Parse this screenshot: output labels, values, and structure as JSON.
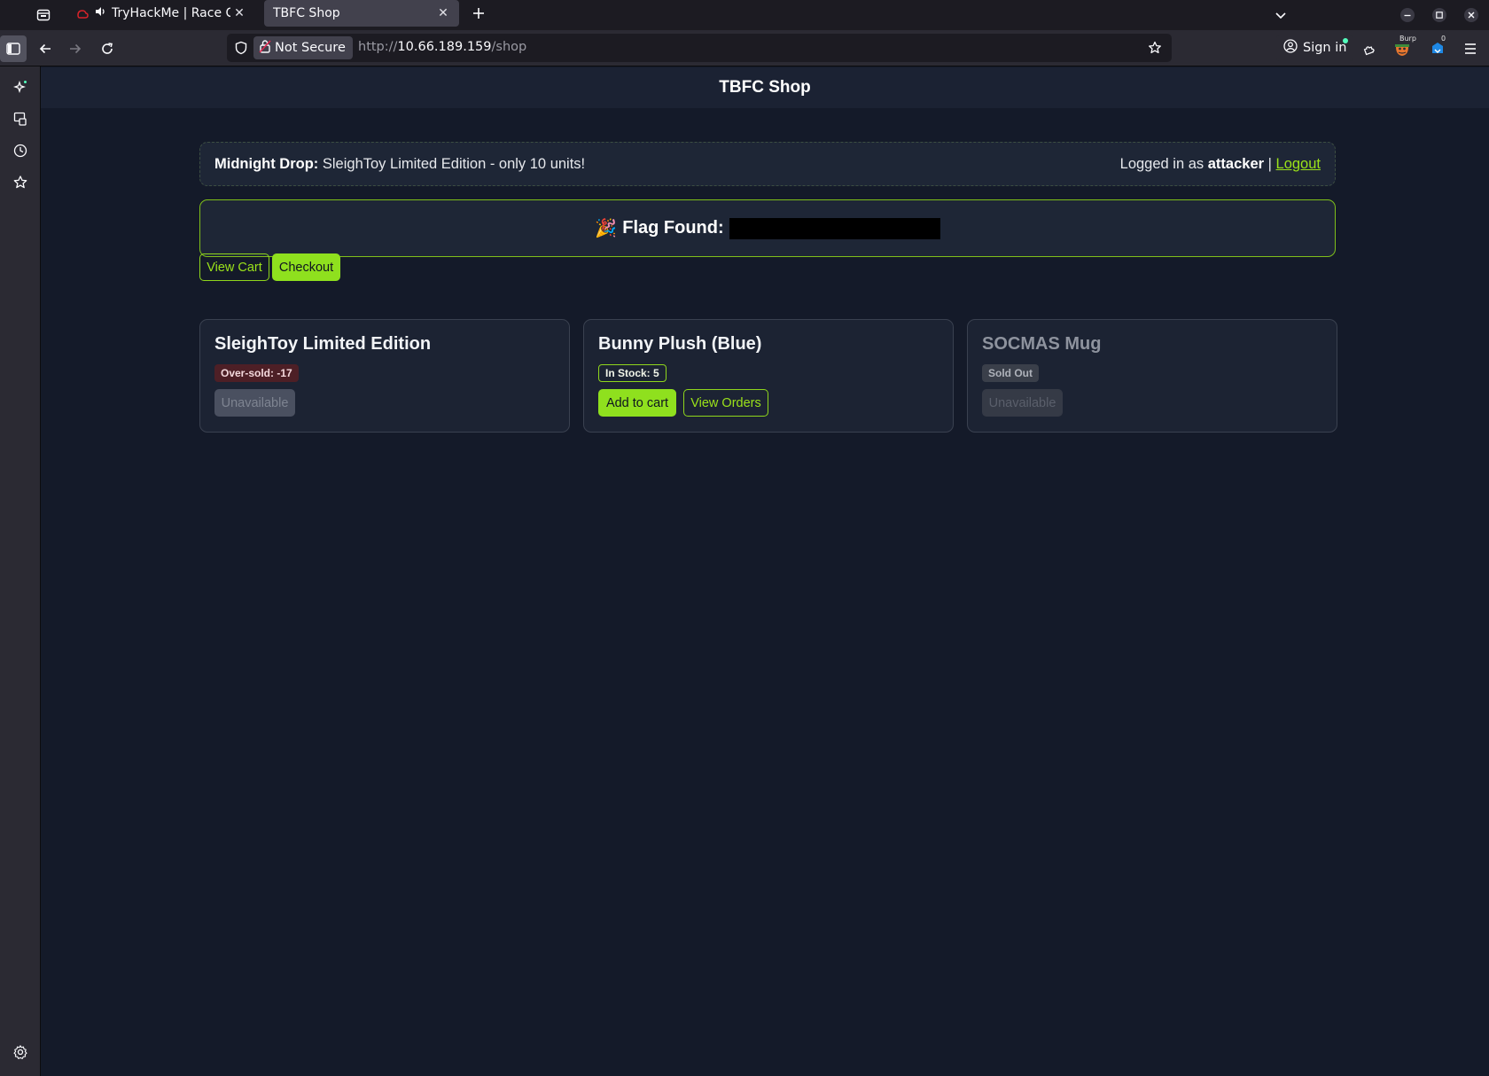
{
  "browser": {
    "tabs": [
      {
        "title": "TryHackMe | Race Cor",
        "active": false,
        "audio": true
      },
      {
        "title": "TBFC Shop",
        "active": true,
        "audio": false
      }
    ],
    "new_tab_label": "+",
    "security_label": "Not Secure",
    "url": {
      "prefix": "http://",
      "host": "10.66.189.159",
      "path": "/shop"
    },
    "sign_in_label": "Sign in",
    "burp_badge": "Burp",
    "ext_count": "0"
  },
  "page": {
    "site_title": "TBFC Shop",
    "banner": {
      "drop_label": "Midnight Drop:",
      "drop_text": "SleighToy Limited Edition - only 10 units!",
      "logged_prefix": "Logged in as",
      "username": "attacker",
      "separator": "|",
      "logout_label": "Logout"
    },
    "flag": {
      "emoji": "🎉",
      "label": "Flag Found:"
    },
    "actions": {
      "view_cart": "View Cart",
      "checkout": "Checkout"
    },
    "products": [
      {
        "name": "SleighToy Limited Edition",
        "badge": "Over-sold: -17",
        "badge_color": "#4d1f26",
        "button": "Unavailable"
      },
      {
        "name": "Bunny Plush (Blue)",
        "badge": "In Stock: 5",
        "badge_color": "#8fd61c",
        "button": "Add to cart",
        "button2": "View Orders"
      },
      {
        "name": "SOCMAS Mug",
        "badge": "Sold Out",
        "badge_color": "#3a3f4a",
        "button": "Unavailable"
      }
    ]
  },
  "colors": {
    "accent": "#8fe01e",
    "page_bg": "#141a29",
    "card_bg": "#1c2333"
  }
}
